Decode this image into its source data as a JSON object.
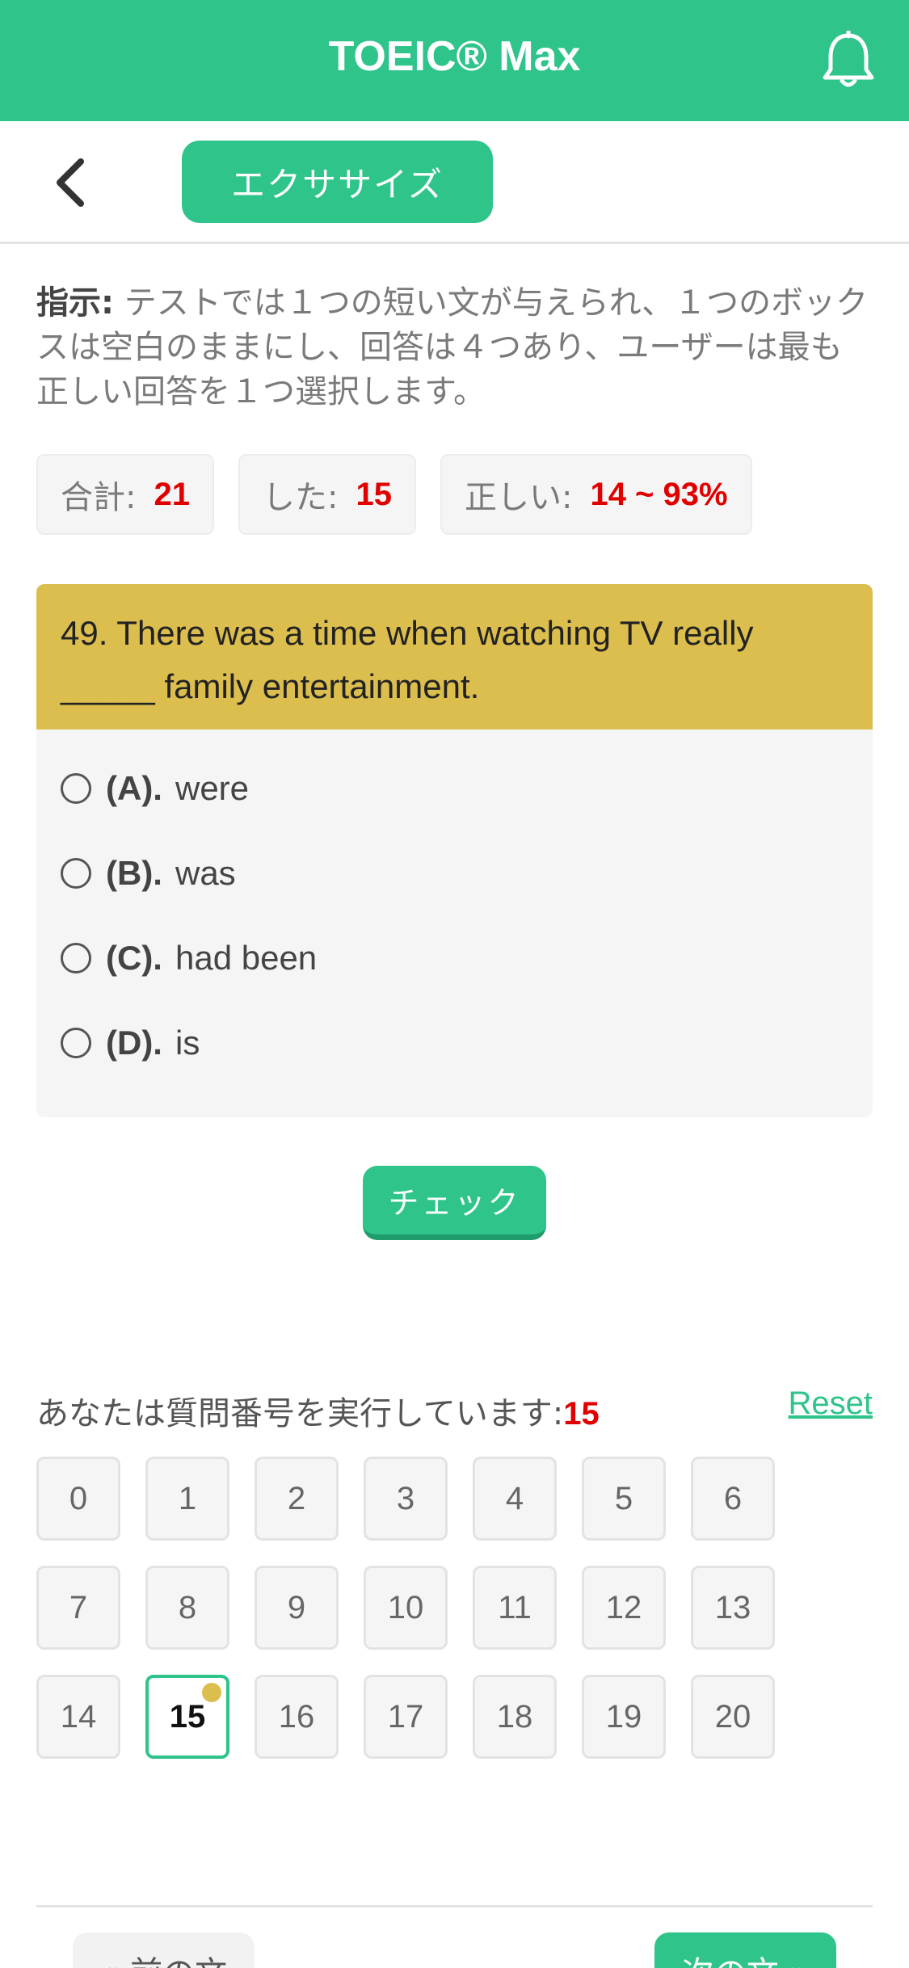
{
  "header": {
    "app_title": "TOEIC® Max",
    "tab_label": "エクササイズ"
  },
  "instructions": {
    "label": "指示:",
    "text": " テストでは１つの短い文が与えられ、１つのボックスは空白のままにし、回答は４つあり、ユーザーは最も正しい回答を１つ選択します。"
  },
  "stats": {
    "total_label": "合計:",
    "total_value": "21",
    "done_label": "した:",
    "done_value": "15",
    "correct_label": "正しい:",
    "correct_value": "14 ~ 93%"
  },
  "question": {
    "text": "49. There was a time when watching TV really _____ family entertainment.",
    "options": [
      {
        "key": "(A).",
        "text": "were"
      },
      {
        "key": "(B).",
        "text": "was"
      },
      {
        "key": "(C).",
        "text": "had been"
      },
      {
        "key": "(D).",
        "text": "is"
      }
    ]
  },
  "check_label": "チェック",
  "progress": {
    "label": "あなたは質問番号を実行しています:",
    "current": "15",
    "reset_label": "Reset",
    "numbers": [
      "0",
      "1",
      "2",
      "3",
      "4",
      "5",
      "6",
      "7",
      "8",
      "9",
      "10",
      "11",
      "12",
      "13",
      "14",
      "15",
      "16",
      "17",
      "18",
      "19",
      "20"
    ]
  },
  "nav": {
    "prev_label": "« 前の文",
    "next_label": "次の文 »"
  },
  "colors": {
    "brand": "#2ec48a",
    "question_head": "#dcbe4f",
    "highlight_red": "#e00000"
  }
}
